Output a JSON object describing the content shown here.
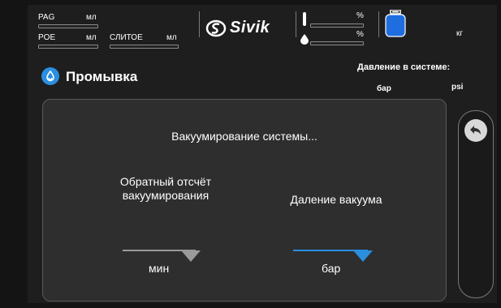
{
  "header": {
    "oil_pag_label": "PAG",
    "oil_pag_unit": "мл",
    "oil_poe_label": "POE",
    "oil_poe_unit": "мл",
    "drain_label": "СЛИТОЕ",
    "drain_unit": "мл",
    "brand": "Sivik",
    "temp_unit": "%",
    "humidity_unit": "%",
    "tank_unit": "кг"
  },
  "title": {
    "text": "Промывка",
    "icon": "flush-icon"
  },
  "pressure": {
    "label": "Давление в системе:",
    "unit_bar": "бар",
    "unit_psi": "psi"
  },
  "panel": {
    "status_text": "Вакуумирование системы...",
    "countdown_title": "Обратный отсчёт\nвакуумирования",
    "countdown_unit": "мин",
    "vacuum_title": "Даление вакуума",
    "vacuum_unit": "бар"
  },
  "colors": {
    "accent": "#2a8fe0",
    "tank": "#1f6ee0",
    "inactive_line": "#9a9a9a"
  },
  "sidebar": {
    "back_icon": "back-arrow-icon"
  }
}
